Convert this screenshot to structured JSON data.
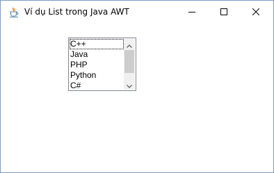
{
  "window": {
    "title": "Ví dụ List trong Java AWT",
    "icon": "java-cup-icon",
    "controls": [
      "minimize-icon",
      "maximize-icon",
      "close-icon"
    ]
  },
  "list": {
    "items": [
      "C++",
      "Java",
      "PHP",
      "Python",
      "C#"
    ],
    "focused_index": 0,
    "scroll_position": 0,
    "visible_fraction": 0.5
  },
  "colors": {
    "border": "#828790",
    "window_border": "#7a9bc4",
    "scroll_thumb": "#cdcdcd",
    "scroll_track": "#f0f0f0"
  }
}
